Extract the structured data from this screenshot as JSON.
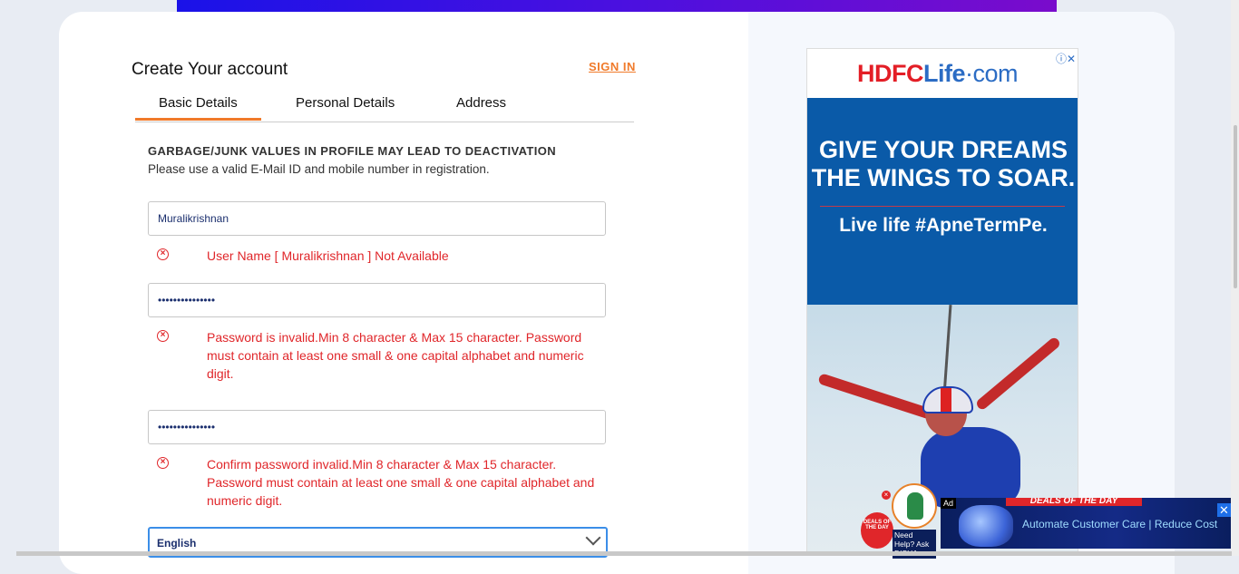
{
  "form": {
    "title": "Create Your account",
    "sign_in": "SIGN IN",
    "tabs": [
      {
        "label": "Basic Details"
      },
      {
        "label": "Personal Details"
      },
      {
        "label": "Address"
      }
    ],
    "warning_title": "GARBAGE/JUNK VALUES IN PROFILE MAY LEAD TO DEACTIVATION",
    "warning_sub": "Please use a valid E-Mail ID and mobile number in registration.",
    "username_value": "Muralikrishnan",
    "username_error": "User Name [ Muralikrishnan ] Not Available",
    "password_value": "•••••••••••••••",
    "password_error": "Password is invalid.Min 8 character & Max 15 character. Password must contain at least one small & one capital alphabet and numeric digit.",
    "confirm_value": "•••••••••••••••",
    "confirm_error": "Confirm password invalid.Min 8 character & Max 15 character. Password must contain at least one small & one capital alphabet and numeric digit.",
    "language_selected": "English"
  },
  "ad": {
    "brand_a": "HDFC",
    "brand_b": "Life",
    "brand_c": "·com",
    "headline": "GIVE YOUR DREAMS THE WINGS TO SOAR.",
    "sub": "Live life #ApneTermPe.",
    "adchoice": "ⓘ✕"
  },
  "bottom_ad": {
    "ad_label": "Ad",
    "deals": "DEALS OF THE DAY",
    "deals_circle": "DEALS OF THE DAY",
    "need_help": "Need Help? Ask DISHA",
    "text": "Automate Customer Care | Reduce Cost",
    "close": "✕"
  },
  "colors": {
    "accent": "#f07a2a",
    "error": "#e0262a",
    "ad_blue": "#0a5aa8"
  }
}
